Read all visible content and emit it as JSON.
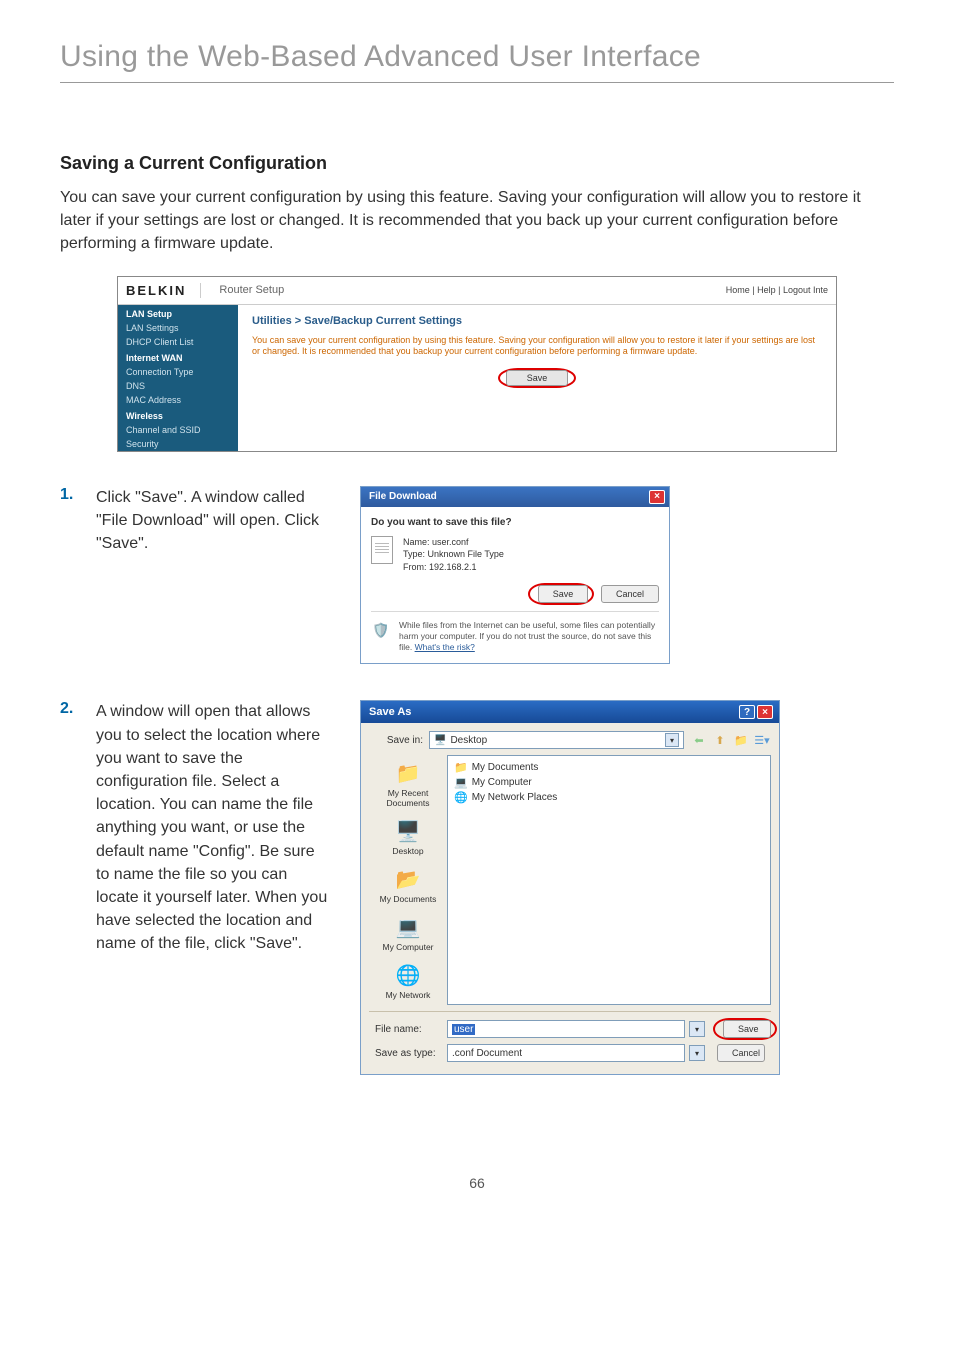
{
  "page": {
    "title": "Using the Web-Based Advanced User Interface",
    "section_title": "Saving a Current Configuration",
    "intro": "You can save your current configuration by using this feature. Saving your configuration will allow you to restore it later if your settings are lost or changed. It is recommended that you back up your current configuration before performing a firmware update.",
    "number": "66"
  },
  "router": {
    "brand": "BELKIN",
    "title": "Router Setup",
    "links": "Home | Help | Logout   Inte",
    "sidebar": {
      "lan_setup": "LAN Setup",
      "lan_settings": "LAN Settings",
      "dhcp": "DHCP Client List",
      "wan": "Internet WAN",
      "conn": "Connection Type",
      "dns": "DNS",
      "mac": "MAC Address",
      "wireless": "Wireless",
      "channel": "Channel and SSID",
      "security": "Security"
    },
    "main": {
      "heading": "Utilities > Save/Backup Current Settings",
      "desc": "You can save your current configuration by using this feature. Saving your configuration will allow you to restore it later if your settings are lost or changed. It is recommended that you backup your current configuration before performing a firmware update.",
      "save_btn": "Save"
    }
  },
  "step1": {
    "num": "1.",
    "text": "Click \"Save\". A window called \"File Download\" will open. Click \"Save\"."
  },
  "dlg1": {
    "title": "File Download",
    "question": "Do you want to save this file?",
    "name_label": "Name:",
    "name_value": "user.conf",
    "type_label": "Type:",
    "type_value": "Unknown File Type",
    "from_label": "From:",
    "from_value": "192.168.2.1",
    "save_btn": "Save",
    "cancel_btn": "Cancel",
    "warning": "While files from the Internet can be useful, some files can potentially harm your computer. If you do not trust the source, do not save this file. ",
    "risk": "What's the risk?"
  },
  "step2": {
    "num": "2.",
    "text": "A window will open that allows you to select the location where you want to save the configuration file. Select a location. You can name the file anything you want, or use the default name \"Config\". Be sure to name the file so you can locate it yourself later. When you have selected the location and name of the file, click \"Save\"."
  },
  "dlg2": {
    "title": "Save As",
    "savein_label": "Save in:",
    "savein_value": "Desktop",
    "items": {
      "mydocs": "My Documents",
      "mycomp": "My Computer",
      "mynet": "My Network Places"
    },
    "places": {
      "recent": "My Recent Documents",
      "desktop": "Desktop",
      "mydocs": "My Documents",
      "mycomp": "My Computer",
      "mynet": "My Network"
    },
    "filename_label": "File name:",
    "filename_value": "user",
    "filetype_label": "Save as type:",
    "filetype_value": ".conf Document",
    "save_btn": "Save",
    "cancel_btn": "Cancel"
  }
}
